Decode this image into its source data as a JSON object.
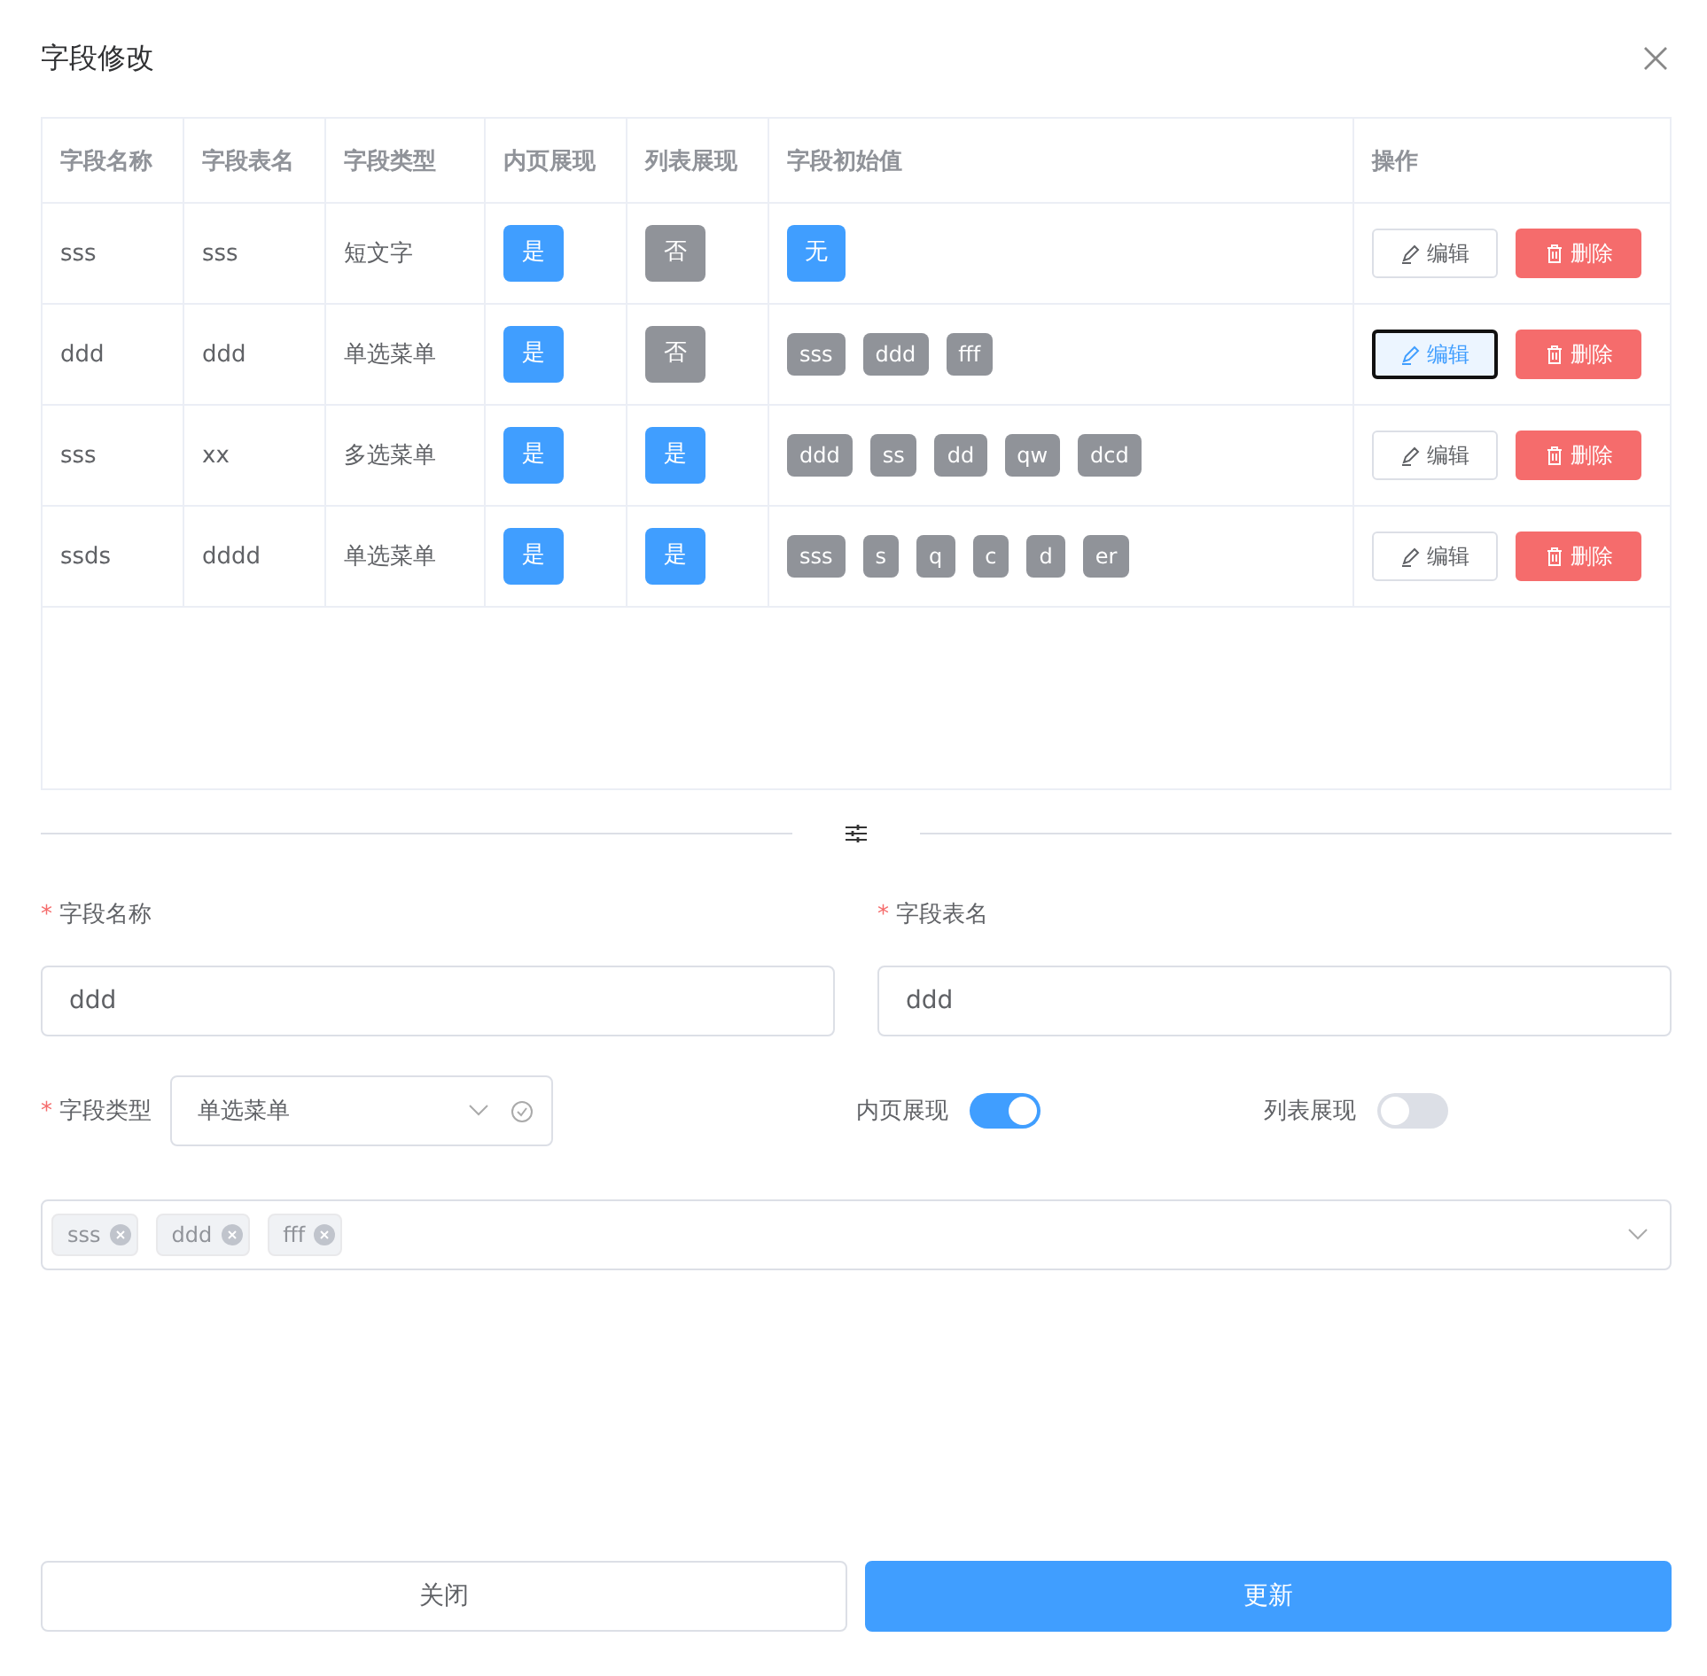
{
  "dialog": {
    "title": "字段修改"
  },
  "table": {
    "columns": [
      "字段名称",
      "字段表名",
      "字段类型",
      "内页展现",
      "列表展现",
      "字段初始值",
      "操作"
    ],
    "rows": [
      {
        "name": "sss",
        "table_name": "sss",
        "type": "短文字",
        "inner_page": {
          "text": "是",
          "on": true
        },
        "list": {
          "text": "否",
          "on": false
        },
        "initial_values": [
          {
            "text": "无",
            "color": "#409eff"
          }
        ],
        "edit": {
          "text": "编辑",
          "focused": false
        },
        "delete": "删除"
      },
      {
        "name": "ddd",
        "table_name": "ddd",
        "type": "单选菜单",
        "inner_page": {
          "text": "是",
          "on": true
        },
        "list": {
          "text": "否",
          "on": false
        },
        "initial_values": [
          {
            "text": "sss",
            "color": "#909399"
          },
          {
            "text": "ddd",
            "color": "#909399"
          },
          {
            "text": "fff",
            "color": "#909399"
          }
        ],
        "edit": {
          "text": "编辑",
          "focused": true
        },
        "delete": "删除"
      },
      {
        "name": "sss",
        "table_name": "xx",
        "type": "多选菜单",
        "inner_page": {
          "text": "是",
          "on": true
        },
        "list": {
          "text": "是",
          "on": true
        },
        "initial_values": [
          {
            "text": "ddd",
            "color": "#909399"
          },
          {
            "text": "ss",
            "color": "#909399"
          },
          {
            "text": "dd",
            "color": "#909399"
          },
          {
            "text": "qw",
            "color": "#909399"
          },
          {
            "text": "dcd",
            "color": "#909399"
          }
        ],
        "edit": {
          "text": "编辑",
          "focused": false
        },
        "delete": "删除"
      },
      {
        "name": "ssds",
        "table_name": "dddd",
        "type": "单选菜单",
        "inner_page": {
          "text": "是",
          "on": true
        },
        "list": {
          "text": "是",
          "on": true
        },
        "initial_values": [
          {
            "text": "sss",
            "color": "#909399"
          },
          {
            "text": "s",
            "color": "#909399"
          },
          {
            "text": "q",
            "color": "#909399"
          },
          {
            "text": "c",
            "color": "#909399"
          },
          {
            "text": "d",
            "color": "#909399"
          },
          {
            "text": "er",
            "color": "#909399"
          }
        ],
        "edit": {
          "text": "编辑",
          "focused": false
        },
        "delete": "删除"
      }
    ]
  },
  "form": {
    "field_name": {
      "required_mark": "*",
      "label": "字段名称",
      "value": "ddd"
    },
    "table_name": {
      "required_mark": "*",
      "label": "字段表名",
      "value": "ddd"
    },
    "field_type": {
      "required_mark": "*",
      "label": "字段类型",
      "value": "单选菜单"
    },
    "inner_page": {
      "label": "内页展现",
      "on": true
    },
    "list_display": {
      "label": "列表展现",
      "on": false
    },
    "options": [
      "sss",
      "ddd",
      "fff"
    ]
  },
  "footer": {
    "close": "关闭",
    "update": "更新"
  }
}
